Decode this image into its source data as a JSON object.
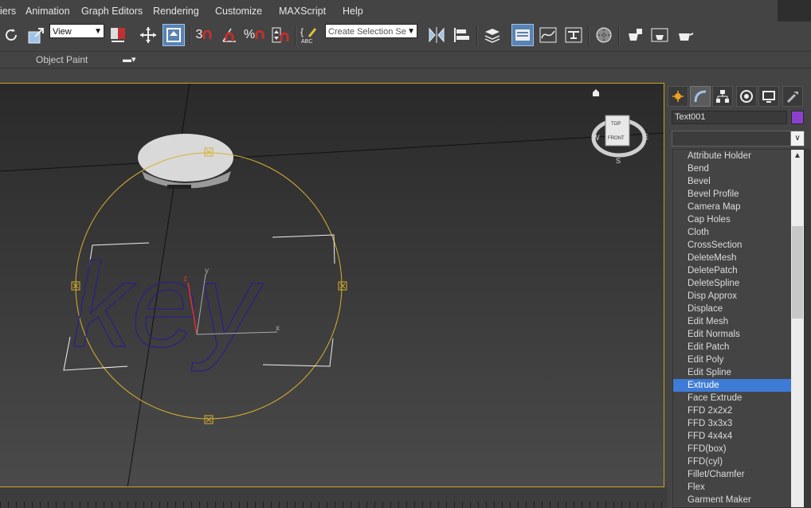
{
  "menu": {
    "items": [
      "iers",
      "Animation",
      "Graph Editors",
      "Rendering",
      "Customize",
      "MAXScript",
      "Help"
    ]
  },
  "toolbar": {
    "view_dropdown": "View",
    "selection_set_placeholder": "Create Selection Se",
    "snap_3_label": "3",
    "percent_label": "%",
    "active_tool": "select-and-place"
  },
  "ribbon": {
    "object_paint_label": "Object Paint"
  },
  "viewport": {
    "text_object": "key",
    "viewcube": {
      "top_label": "TOP",
      "front_label": "FRONT",
      "west": "W",
      "east": "E",
      "south": "S"
    },
    "gizmo": {
      "x_label": "x",
      "y_label": "y",
      "z_label": "z"
    }
  },
  "command_panel": {
    "object_name": "Text001",
    "object_color": "#8e3fd0",
    "modifier_list": {
      "selected": "Extrude",
      "items": [
        "Attribute Holder",
        "Bend",
        "Bevel",
        "Bevel Profile",
        "Camera Map",
        "Cap Holes",
        "Cloth",
        "CrossSection",
        "DeleteMesh",
        "DeletePatch",
        "DeleteSpline",
        "Disp Approx",
        "Displace",
        "Edit Mesh",
        "Edit Normals",
        "Edit Patch",
        "Edit Poly",
        "Edit Spline",
        "Extrude",
        "Face Extrude",
        "FFD 2x2x2",
        "FFD 3x3x3",
        "FFD 4x4x4",
        "FFD(box)",
        "FFD(cyl)",
        "Fillet/Chamfer",
        "Flex",
        "Garment Maker"
      ]
    }
  },
  "colors": {
    "accent_selection": "#3e7bd6",
    "viewport_border": "#c8a028",
    "shape_lines": "#2a1f8a"
  }
}
